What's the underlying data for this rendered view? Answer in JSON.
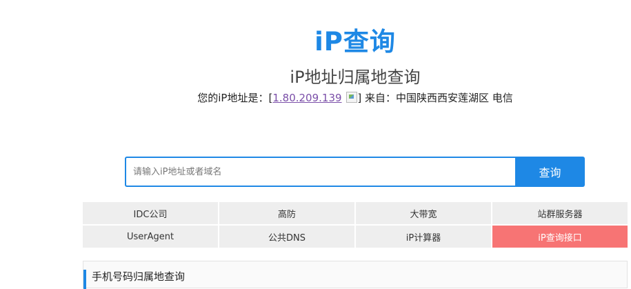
{
  "logo": {
    "text": "iP查询"
  },
  "subtitle": "iP地址归属地查询",
  "ip_info": {
    "prefix": "您的iP地址是：[",
    "ip": "1.80.209.139",
    "suffix": "] 来自：中国陕西西安莲湖区 电信"
  },
  "search": {
    "placeholder": "请输入iP地址或者域名",
    "value": "",
    "button_label": "查询"
  },
  "links": [
    {
      "label": "IDC公司",
      "highlight": false
    },
    {
      "label": "高防",
      "highlight": false
    },
    {
      "label": "大带宽",
      "highlight": false
    },
    {
      "label": "站群服务器",
      "highlight": false
    },
    {
      "label": "UserAgent",
      "highlight": false
    },
    {
      "label": "公共DNS",
      "highlight": false
    },
    {
      "label": "iP计算器",
      "highlight": false
    },
    {
      "label": "iP查询接口",
      "highlight": true
    }
  ],
  "colors": {
    "accent": "#1e88e5",
    "highlight": "#f77474",
    "link_visited": "#7a4ea8"
  },
  "section": {
    "title": "手机号码归属地查询"
  }
}
